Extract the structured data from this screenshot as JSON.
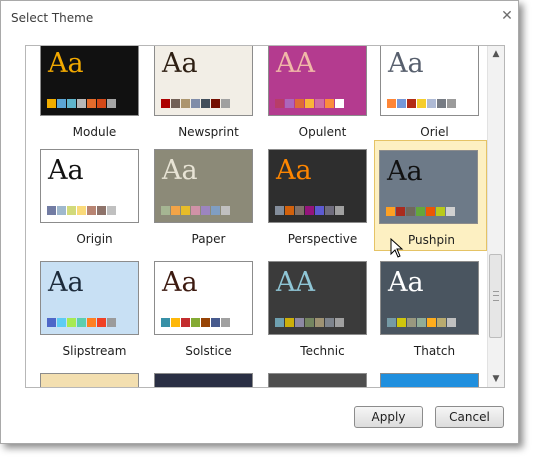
{
  "dialog": {
    "title": "Select Theme",
    "close_label": "✕",
    "apply_label": "Apply",
    "cancel_label": "Cancel"
  },
  "gallery": {
    "selected_theme": "Pushpin",
    "themes": [
      {
        "name": "Module",
        "aa": "Aa",
        "bg": "#111111",
        "aa_color": "#f2a900",
        "swatches": [
          "#f0ad00",
          "#5ca6d6",
          "#60b5cc",
          "#b7b7b7",
          "#e36b2c",
          "#d34817",
          "#a5a5a5"
        ]
      },
      {
        "name": "Newsprint",
        "aa": "Aa",
        "bg": "#f2eee6",
        "aa_color": "#2d1e12",
        "swatches": [
          "#ad0101",
          "#726056",
          "#ac956e",
          "#808da9",
          "#424e5b",
          "#730e00",
          "#a0a0a0"
        ]
      },
      {
        "name": "Opulent",
        "aa": "AA",
        "bg": "#b43b8f",
        "aa_color": "#f0b8a8",
        "swatches": [
          "#b83d68",
          "#ac66bb",
          "#de6c36",
          "#f9b639",
          "#cf6da4",
          "#fa8d3d",
          "#ffffff"
        ]
      },
      {
        "name": "Oriel",
        "aa": "Aa",
        "bg": "#ffffff",
        "aa_color": "#575f6d",
        "swatches": [
          "#fe8637",
          "#7598d9",
          "#b32c16",
          "#f5cd2d",
          "#aebad5",
          "#777c84",
          "#9b9b9b"
        ]
      },
      {
        "name": "Origin",
        "aa": "Aa",
        "bg": "#ffffff",
        "aa_color": "#111111",
        "swatches": [
          "#727ca3",
          "#9fb8cd",
          "#d2da7a",
          "#fada7a",
          "#b88472",
          "#8e736a",
          "#c0c0c0"
        ]
      },
      {
        "name": "Paper",
        "aa": "Aa",
        "bg": "#8c8a78",
        "aa_color": "#e8e4d5",
        "swatches": [
          "#a5b592",
          "#f3a447",
          "#e7bc29",
          "#d092a7",
          "#9c85c0",
          "#809ec2",
          "#c0c0c0"
        ]
      },
      {
        "name": "Perspective",
        "aa": "Aa",
        "bg": "#2e2e2e",
        "aa_color": "#ff8600",
        "swatches": [
          "#838d9b",
          "#d2610c",
          "#80716a",
          "#94147c",
          "#5d5ad2",
          "#6f6c7d",
          "#a0a0a0"
        ]
      },
      {
        "name": "Pushpin",
        "aa": "Aa",
        "bg": "#6d7a88",
        "aa_color": "#111111",
        "swatches": [
          "#fda023",
          "#aa2b1e",
          "#71685c",
          "#64a73b",
          "#eb5605",
          "#b9ca1a",
          "#d0d0d0"
        ]
      },
      {
        "name": "Slipstream",
        "aa": "Aa",
        "bg": "#c8e0f4",
        "aa_color": "#1c2a3a",
        "swatches": [
          "#4e67c8",
          "#5eccf3",
          "#a7ea52",
          "#5dceaf",
          "#ff8021",
          "#f14124",
          "#9b9b9b"
        ]
      },
      {
        "name": "Solstice",
        "aa": "Aa",
        "bg": "#ffffff",
        "aa_color": "#3c1a10",
        "swatches": [
          "#3891a7",
          "#feb80a",
          "#c32d2e",
          "#84aa33",
          "#964305",
          "#475a8d",
          "#a0a0a0"
        ]
      },
      {
        "name": "Technic",
        "aa": "AA",
        "bg": "#3b3b3b",
        "aa_color": "#8fc6d6",
        "swatches": [
          "#6ea0b0",
          "#ccaf0a",
          "#8d89a4",
          "#748560",
          "#9e9273",
          "#7e848d",
          "#a0a0a0"
        ]
      },
      {
        "name": "Thatch",
        "aa": "Aa",
        "bg": "#4a5560",
        "aa_color": "#ffffff",
        "swatches": [
          "#759aa5",
          "#cfc60d",
          "#99987f",
          "#90ac97",
          "#ffad1c",
          "#b9ab6f",
          "#c0c0c0"
        ]
      },
      {
        "name": "",
        "aa": "",
        "bg": "#f3dfb0",
        "aa_color": "#333333",
        "swatches": []
      },
      {
        "name": "",
        "aa": "",
        "bg": "#2a2f44",
        "aa_color": "#ffffff",
        "swatches": []
      },
      {
        "name": "",
        "aa": "",
        "bg": "#4e4e4e",
        "aa_color": "#ffffff",
        "swatches": []
      },
      {
        "name": "",
        "aa": "",
        "bg": "#1f8fde",
        "aa_color": "#ffffff",
        "swatches": []
      }
    ]
  }
}
